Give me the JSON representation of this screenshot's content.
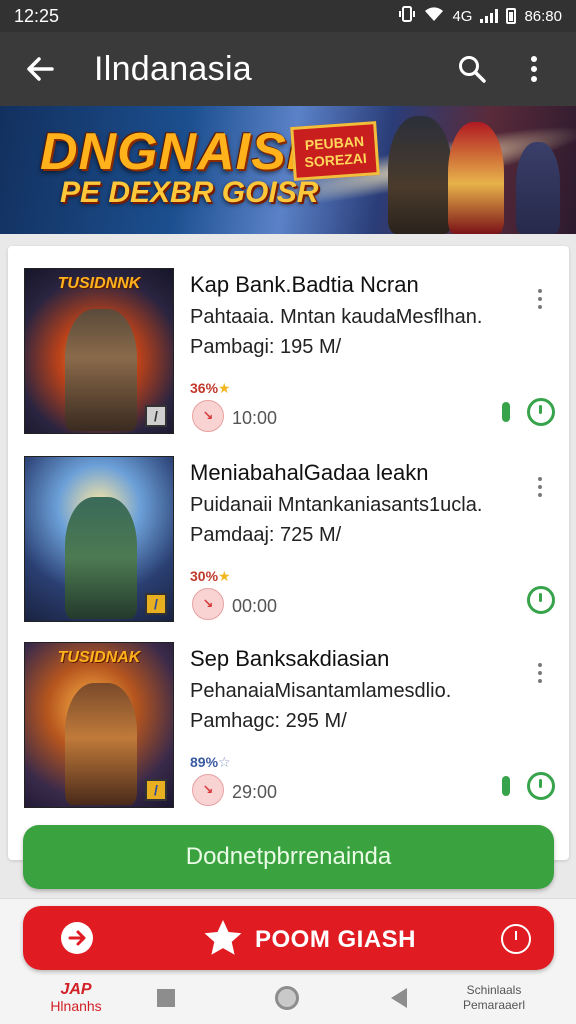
{
  "status_bar": {
    "time": "12:25",
    "extra": "4G",
    "battery_text": "86:80"
  },
  "app_bar": {
    "title": "Ilndanasia",
    "back_icon": "arrow-back-icon",
    "search_icon": "search-icon",
    "menu_icon": "more-vert-icon"
  },
  "banner": {
    "title": "DNGNAISI",
    "subtitle": "PE DEXBR GOISR",
    "badge_line1": "PEUBAN",
    "badge_line2": "SOREZAI"
  },
  "items": [
    {
      "thumb_label": "TUSIDNNK",
      "title": "Kap Bank.Badtia Ncran",
      "description": "Pahtaaia. Mntan kaudaMesflhan.",
      "size": "Pambagi: 195 M/",
      "rating": "36%",
      "time": "10:00",
      "show_progress": true
    },
    {
      "thumb_label": "",
      "title": "MeniabahalGadaa leakn",
      "description": "Puidanaii Mntankaniasants1ucla.",
      "size": "Pamdaaj: 725 M/",
      "rating": "30%",
      "time": "00:00",
      "show_progress": false
    },
    {
      "thumb_label": "TUSIDNAK",
      "title": "Sep Banksakdiasian",
      "description": "PehanaiaMisantamlamesdlio.",
      "size": "Pamhagc: 295 M/",
      "rating": "89%",
      "time": "29:00",
      "show_progress": true
    }
  ],
  "primary_button": {
    "label": "Dodnetpbrrenainda"
  },
  "promo_button": {
    "label": "POOM GIASH"
  },
  "nav_bar": {
    "left_logo": "JAP",
    "left_caption": "Hlnanhs",
    "right_caption_1": "Schinlaals",
    "right_caption_2": "Pemaraaerl"
  },
  "colors": {
    "accent_green": "#3aa340",
    "accent_red": "#e11b22",
    "app_bar": "#3a3a3a"
  }
}
